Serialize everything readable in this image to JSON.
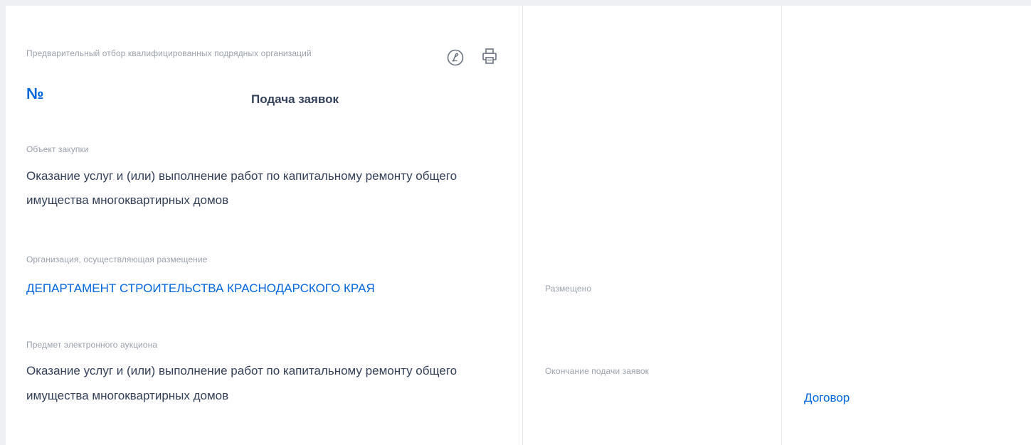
{
  "registry": {
    "procedure_type": "Предварительный отбор квалифицированных подрядных организаций",
    "number_prefix": "№",
    "status": "Подача заявок",
    "icons": {
      "sign": "signature-icon",
      "print": "printer-icon"
    }
  },
  "fields": {
    "object_label": "Объект закупки",
    "object_value_line1": "Оказание услуг и (или) выполнение работ по капитальному ремонту общего",
    "object_value_line2": "имущества многоквартирных домов",
    "organization_label": "Организация, осуществляющая размещение",
    "organization_value": "ДЕПАРТАМЕНТ СТРОИТЕЛЬСТВА КРАСНОДАРСКОГО КРАЯ",
    "subject_label": "Предмет электронного аукциона",
    "subject_value_line1": "Оказание услуг и (или) выполнение работ по капитальному ремонту общего",
    "subject_value_line2": "имущества многоквартирных домов"
  },
  "dates": {
    "posted_label": "Размещено",
    "deadline_label": "Окончание подачи заявок"
  },
  "side": {
    "contract_link": "Договор"
  },
  "colors": {
    "link": "#0065dd",
    "label": "#9aa1ac",
    "text": "#334059",
    "background": "#eef0f4"
  }
}
